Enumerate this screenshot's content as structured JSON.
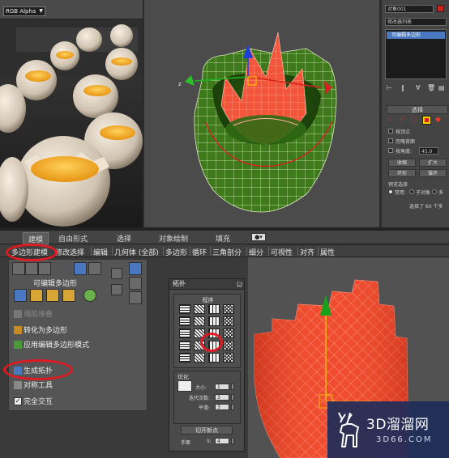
{
  "render_window": {
    "channel_value": "RGB Alpha"
  },
  "command_panel": {
    "object_name": "对象001",
    "modifier_list_label": "修改器列表",
    "modifier_item": "可编辑多边形",
    "selection_title": "选择",
    "by_vertex": "按顶点",
    "ignore_backfacing": "忽略背面",
    "by_angle": "按角度:",
    "angle_value": "45.0",
    "shrink": "收缩",
    "grow": "扩大",
    "ring": "环形",
    "loop": "循环",
    "preview_selection": "预览选择",
    "disabled": "禁用",
    "subobject": "子对象",
    "multi": "多",
    "selected_count": "选择了 60 个多"
  },
  "ribbon": {
    "tabs": [
      "建模",
      "自由形式",
      "选择",
      "对象绘制",
      "填充"
    ],
    "sub_tabs": [
      "多边形建模",
      "修改选择",
      "编辑",
      "几何体 (全部)",
      "多边形",
      "循环",
      "三角剖分",
      "细分",
      "可视性",
      "对齐",
      "属性"
    ],
    "panel_title": "可编辑多边形",
    "menu_items": [
      "塌陷堆叠",
      "转化为多边形",
      "应用编辑多边形模式",
      "生成拓扑",
      "对称工具",
      "完全交互"
    ]
  },
  "topology_dialog": {
    "title": "拓扑",
    "group_label": "程序",
    "optimize_label": "优化",
    "size_label": "大小:",
    "size_value": "1",
    "iterations_label": "迭代次数:",
    "iterations_value": "3",
    "smooth_label": "平滑:",
    "smooth_value": "3",
    "weld_button": "切开新点",
    "manual_label": "手面",
    "sides_label": "S:",
    "sides_value": "4"
  },
  "watermark": {
    "brand": "3D溜溜网",
    "site": "3D66.COM"
  },
  "colors": {
    "highlight_red": "#e01a22",
    "mesh_green": "#3e7a1c",
    "mesh_red": "#f2553a",
    "gizmo_yellow": "#f5d400"
  }
}
